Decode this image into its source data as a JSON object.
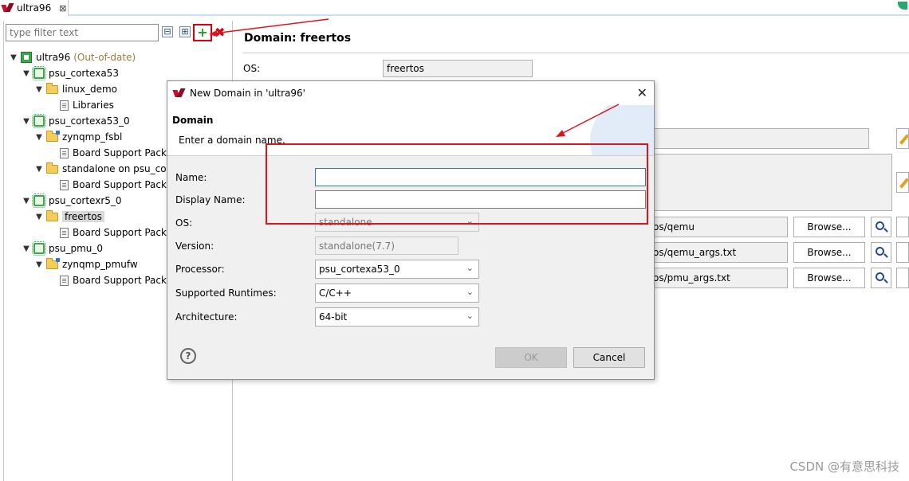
{
  "tab": {
    "label": "ultra96",
    "close": "⊠"
  },
  "explorer": {
    "filter_placeholder": "type filter text",
    "collapse_all": "⊟",
    "expand_all": "⊞",
    "add": "+",
    "remove": "✖",
    "tree": [
      {
        "label": "ultra96",
        "suffix": "(Out-of-date)",
        "icon": "system-icon",
        "level": 0
      },
      {
        "label": "psu_cortexa53",
        "icon": "processor-icon",
        "level": 1
      },
      {
        "label": "linux_demo",
        "icon": "folder-icon",
        "level": 2
      },
      {
        "label": "Libraries",
        "icon": "document-icon",
        "level": 3
      },
      {
        "label": "psu_cortexa53_0",
        "icon": "processor-icon",
        "level": 1
      },
      {
        "label": "zynqmp_fsbl",
        "icon": "folder-bsp-icon",
        "level": 2
      },
      {
        "label": "Board Support Pack",
        "icon": "document-icon",
        "level": 3
      },
      {
        "label": "standalone on psu_cor",
        "icon": "folder-icon",
        "level": 2
      },
      {
        "label": "Board Support Pack",
        "icon": "document-icon",
        "level": 3
      },
      {
        "label": "psu_cortexr5_0",
        "icon": "processor-icon",
        "level": 1
      },
      {
        "label": "freertos",
        "icon": "folder-icon",
        "level": 2,
        "selected": true
      },
      {
        "label": "Board Support Pack",
        "icon": "document-icon",
        "level": 3
      },
      {
        "label": "psu_pmu_0",
        "icon": "processor-icon",
        "level": 1
      },
      {
        "label": "zynqmp_pmufw",
        "icon": "folder-bsp-icon",
        "level": 2
      },
      {
        "label": "Board Support Pack",
        "icon": "document-icon",
        "level": 3
      }
    ]
  },
  "domain_page": {
    "heading": "Domain: freertos",
    "os_label": "OS:",
    "os_value": "freertos",
    "paths": [
      "os/qemu",
      "os/qemu_args.txt",
      "os/pmu_args.txt"
    ],
    "browse_label": "Browse..."
  },
  "dialog": {
    "title": "New Domain in 'ultra96'",
    "close": "✕",
    "header_title": "Domain",
    "header_msg": "Enter a domain name.",
    "fields": {
      "name_label": "Name:",
      "name_value": "",
      "display_name_label": "Display Name:",
      "display_name_value": "",
      "os_label": "OS:",
      "os_value": "standalone",
      "version_label": "Version:",
      "version_value": "standalone(7.7)",
      "processor_label": "Processor:",
      "processor_value": "psu_cortexa53_0",
      "runtimes_label": "Supported Runtimes:",
      "runtimes_value": "C/C++",
      "arch_label": "Architecture:",
      "arch_value": "64-bit"
    },
    "help": "?",
    "ok_label": "OK",
    "cancel_label": "Cancel"
  },
  "watermark": "CSDN @有意思科技",
  "colors": {
    "annotation": "#e0141b",
    "accent": "#2b78c8"
  }
}
